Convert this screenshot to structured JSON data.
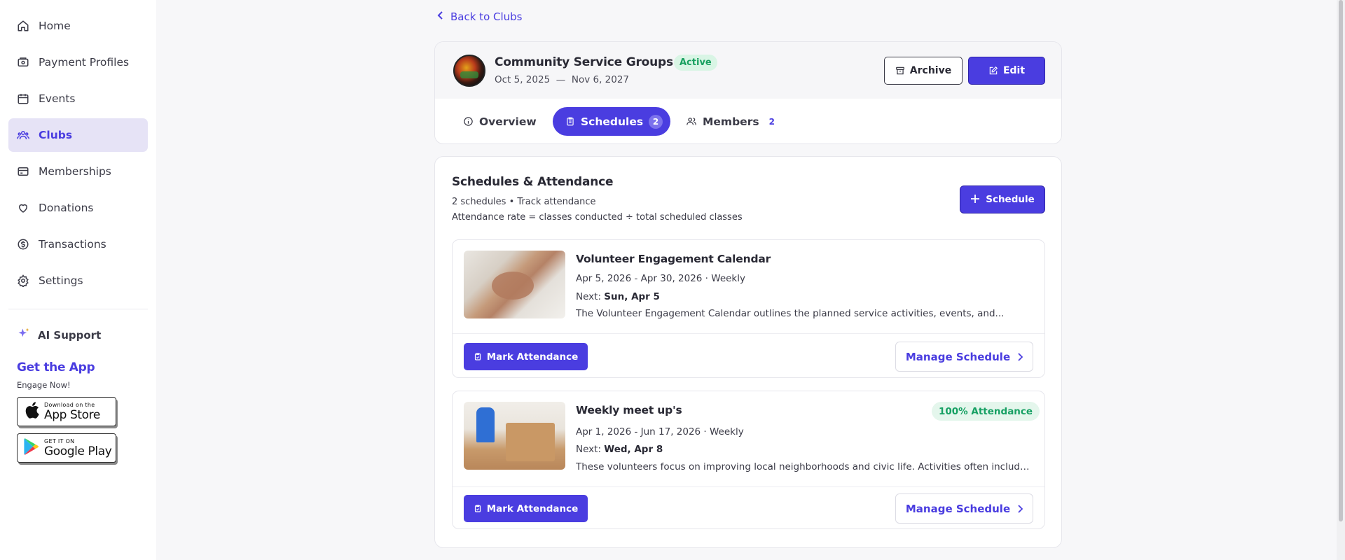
{
  "sidebar": {
    "items": [
      {
        "label": "Home",
        "icon": "home-icon"
      },
      {
        "label": "Payment Profiles",
        "icon": "wallet-icon"
      },
      {
        "label": "Events",
        "icon": "calendar-icon"
      },
      {
        "label": "Clubs",
        "icon": "users-icon",
        "active": true
      },
      {
        "label": "Memberships",
        "icon": "card-icon"
      },
      {
        "label": "Donations",
        "icon": "heart-icon"
      },
      {
        "label": "Transactions",
        "icon": "dollar-circle-icon"
      },
      {
        "label": "Settings",
        "icon": "gear-icon"
      }
    ],
    "ai_support": "AI Support",
    "get_app": {
      "title": "Get the App",
      "subtitle": "Engage Now!",
      "app_store_small": "Download on the",
      "app_store_big": "App Store",
      "google_small": "GET IT ON",
      "google_big": "Google Play"
    }
  },
  "back_link": "Back to Clubs",
  "club": {
    "name": "Community Service Groups",
    "status": "Active",
    "start_date": "Oct 5, 2025",
    "date_sep": "—",
    "end_date": "Nov 6, 2027",
    "archive_label": "Archive",
    "edit_label": "Edit"
  },
  "tabs": {
    "overview": "Overview",
    "schedules": "Schedules",
    "schedules_count": "2",
    "members": "Members",
    "members_count": "2"
  },
  "schedules": {
    "title": "Schedules & Attendance",
    "subtitle": "2 schedules • Track attendance",
    "rate_note": "Attendance rate = classes conducted ÷ total scheduled classes",
    "add_label": "Schedule",
    "items": [
      {
        "title": "Volunteer Engagement Calendar",
        "dates": "Apr 5, 2026 - Apr 30, 2026 · Weekly",
        "next_label": "Next: ",
        "next_value": "Sun, Apr 5",
        "description": "The Volunteer Engagement Calendar outlines the planned service activities, events, and...",
        "mark_label": "Mark Attendance",
        "manage_label": "Manage Schedule"
      },
      {
        "title": "Weekly meet up's",
        "dates": "Apr 1, 2026 - Jun 17, 2026 · Weekly",
        "next_label": "Next: ",
        "next_value": "Wed, Apr 8",
        "description": "These volunteers focus on improving local neighborhoods and civic life. Activities often include...",
        "attendance_badge": "100% Attendance",
        "mark_label": "Mark Attendance",
        "manage_label": "Manage Schedule"
      }
    ]
  },
  "colors": {
    "accent": "#4a3de0",
    "success": "#16a063",
    "active_nav_bg": "#e6e3f6"
  }
}
